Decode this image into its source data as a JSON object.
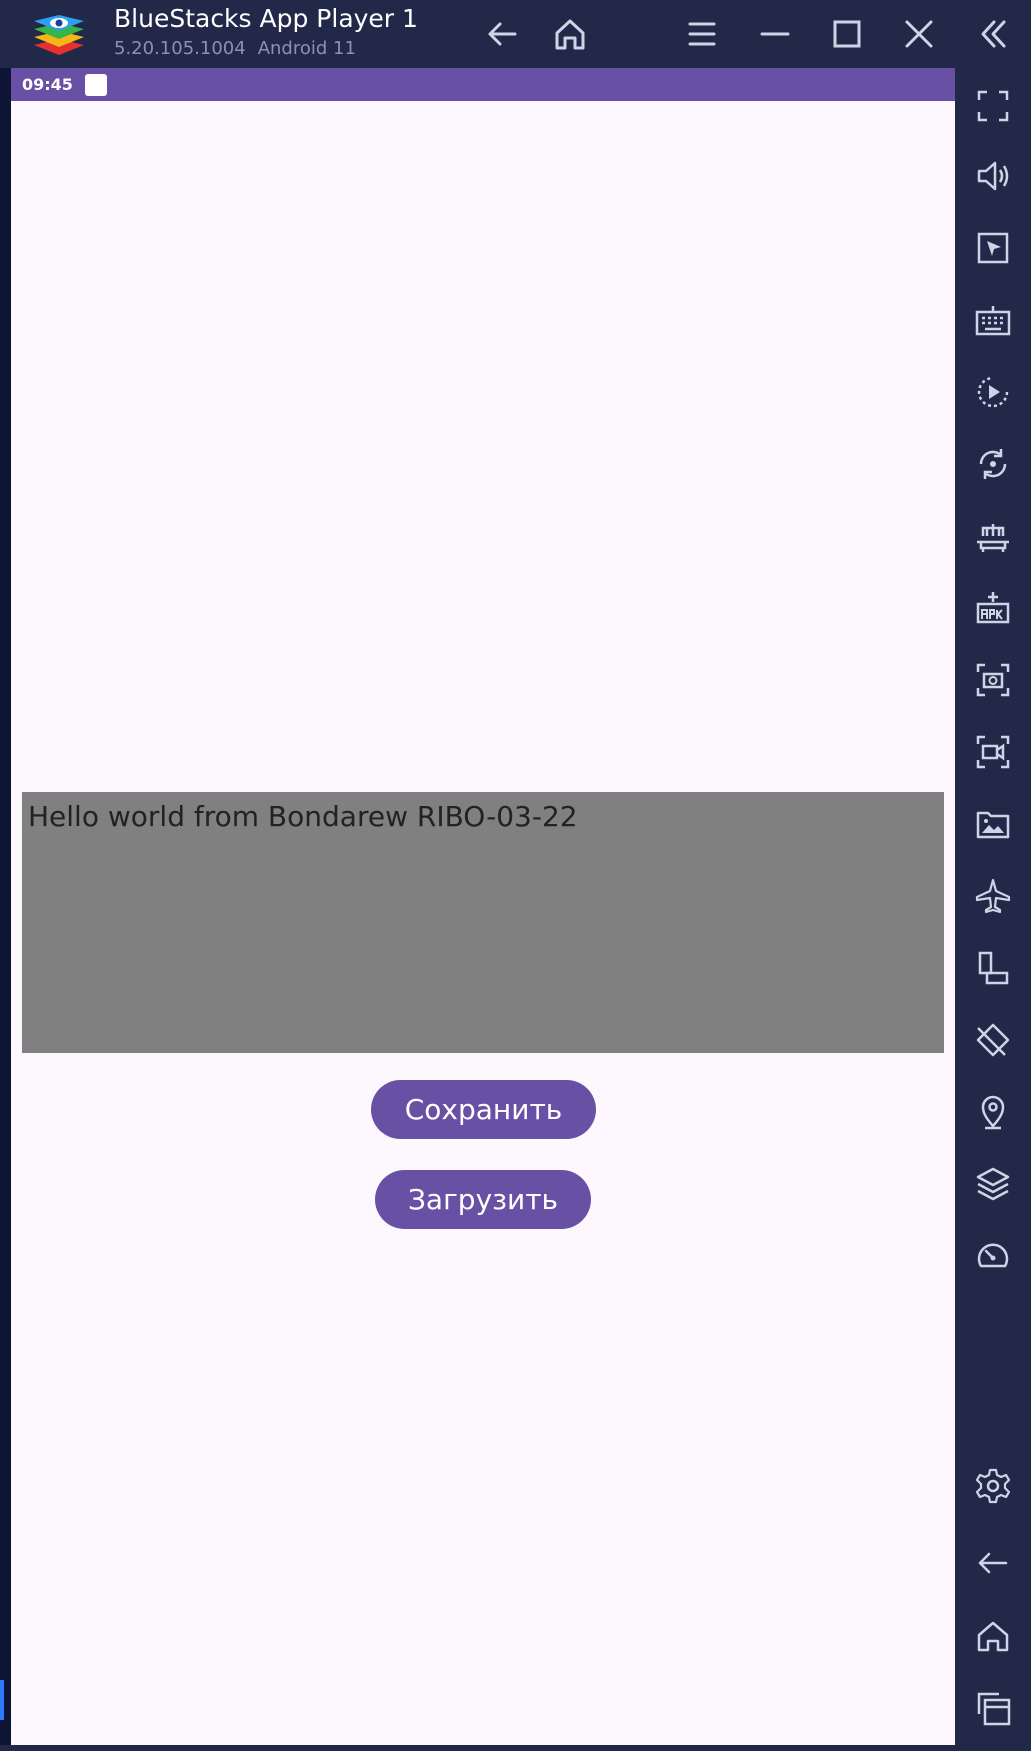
{
  "window": {
    "title": "BlueStacks App Player 1",
    "version": "5.20.105.1004",
    "android": "Android 11"
  },
  "titlebar_icons": [
    "bluestacks-logo",
    "back-arrow-icon",
    "home-icon",
    "menu-icon",
    "minimize-icon",
    "maximize-icon",
    "close-icon",
    "collapse-icon"
  ],
  "right_toolbar_icons": [
    "fullscreen-icon",
    "volume-icon",
    "pointer-icon",
    "keyboard-icon",
    "macro-play-icon",
    "sync-rotate-icon",
    "multi-instance-icon",
    "install-apk-icon",
    "screenshot-icon",
    "record-icon",
    "media-folder-icon",
    "airplane-icon",
    "rotate-device-icon",
    "eco-mode-icon",
    "location-icon",
    "layers-icon",
    "performance-icon",
    "settings-icon",
    "back-icon",
    "home-icon",
    "recent-apps-icon"
  ],
  "status_bar": {
    "time": "09:45"
  },
  "app": {
    "text_view": "Hello world from Bondarew RIBO-03-22",
    "save_button": "Сохранить",
    "load_button": "Загрузить"
  },
  "colors": {
    "accent": "#6850a4",
    "chrome": "#222848",
    "screen_bg": "#fdf7fe",
    "text_box_bg": "#808080"
  }
}
